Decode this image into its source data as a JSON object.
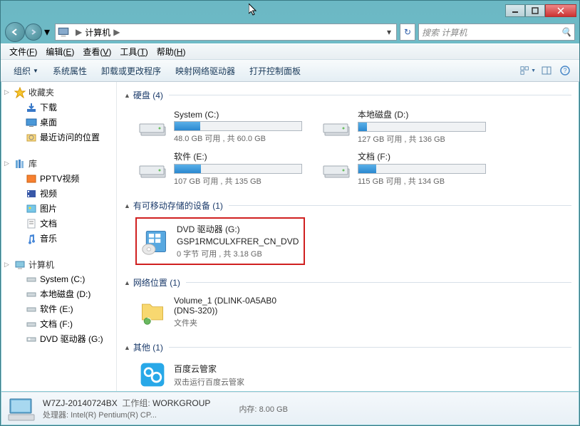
{
  "title_controls": {
    "minimize": "–",
    "maximize": "□",
    "close": "✕"
  },
  "breadcrumb": {
    "label": "计算机",
    "arrow": "▶"
  },
  "search": {
    "placeholder": "搜索 计算机"
  },
  "menubar": [
    {
      "label": "文件",
      "key": "F"
    },
    {
      "label": "编辑",
      "key": "E"
    },
    {
      "label": "查看",
      "key": "V"
    },
    {
      "label": "工具",
      "key": "T"
    },
    {
      "label": "帮助",
      "key": "H"
    }
  ],
  "toolbar": {
    "organize": "组织",
    "items": [
      "系统属性",
      "卸载或更改程序",
      "映射网络驱动器",
      "打开控制面板"
    ]
  },
  "sidebar": {
    "favorites": {
      "label": "收藏夹",
      "items": [
        "下载",
        "桌面",
        "最近访问的位置"
      ]
    },
    "libraries": {
      "label": "库",
      "items": [
        "PPTV视频",
        "视频",
        "图片",
        "文档",
        "音乐"
      ]
    },
    "computer": {
      "label": "计算机",
      "items": [
        "System (C:)",
        "本地磁盘 (D:)",
        "软件 (E:)",
        "文档 (F:)",
        "DVD 驱动器 (G:)"
      ]
    }
  },
  "sections": {
    "hdd": {
      "label": "硬盘 (4)",
      "drives": [
        {
          "name": "System (C:)",
          "stat": "48.0 GB 可用 , 共 60.0 GB",
          "pct": 20
        },
        {
          "name": "本地磁盘 (D:)",
          "stat": "127 GB 可用 , 共 136 GB",
          "pct": 7
        },
        {
          "name": "软件 (E:)",
          "stat": "107 GB 可用 , 共 135 GB",
          "pct": 21
        },
        {
          "name": "文档 (F:)",
          "stat": "115 GB 可用 , 共 134 GB",
          "pct": 14
        }
      ]
    },
    "removable": {
      "label": "有可移动存储的设备 (1)",
      "drive": {
        "name": "DVD 驱动器 (G:)",
        "sub": "GSP1RMCULXFRER_CN_DVD",
        "stat": "0 字节 可用 , 共 3.18 GB"
      }
    },
    "network": {
      "label": "网络位置 (1)",
      "item": {
        "name": "Volume_1 (DLINK-0A5AB0 (DNS-320))",
        "stat": "文件夹"
      }
    },
    "other": {
      "label": "其他 (1)",
      "item": {
        "name": "百度云管家",
        "stat": "双击运行百度云管家"
      }
    }
  },
  "details": {
    "name": "W7ZJ-20140724BX",
    "workgroup_lbl": "工作组:",
    "workgroup": "WORKGROUP",
    "mem_lbl": "内存:",
    "mem": "8.00 GB",
    "cpu_lbl": "处理器:",
    "cpu": "Intel(R) Pentium(R) CP..."
  }
}
